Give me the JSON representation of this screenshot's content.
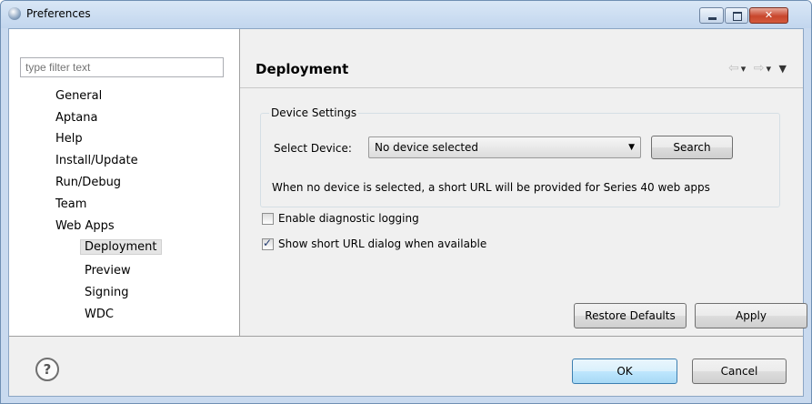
{
  "window": {
    "title": "Preferences"
  },
  "filter": {
    "placeholder": "type filter text"
  },
  "tree": [
    {
      "label": "General"
    },
    {
      "label": "Aptana"
    },
    {
      "label": "Help"
    },
    {
      "label": "Install/Update"
    },
    {
      "label": "Run/Debug"
    },
    {
      "label": "Team"
    },
    {
      "label": "Web Apps"
    },
    {
      "label": "Deployment"
    },
    {
      "label": "Preview"
    },
    {
      "label": "Signing"
    },
    {
      "label": "WDC"
    }
  ],
  "page": {
    "title": "Deployment",
    "group_label": "Device Settings",
    "select_label": "Select Device:",
    "select_value": "No device selected",
    "search_button": "Search",
    "hint": "When no device is selected, a short URL will be provided for Series 40 web apps",
    "checkboxes": [
      {
        "label": "Enable diagnostic logging",
        "checked": false
      },
      {
        "label": "Show short URL dialog when available",
        "checked": true
      }
    ],
    "restore_defaults": "Restore Defaults",
    "apply": "Apply"
  },
  "footer": {
    "help_glyph": "?",
    "ok": "OK",
    "cancel": "Cancel"
  },
  "icons": {
    "app": "preferences-globe-icon",
    "nav_back": "back-arrow-icon",
    "nav_forward": "forward-arrow-icon",
    "view_menu": "view-menu-icon"
  }
}
